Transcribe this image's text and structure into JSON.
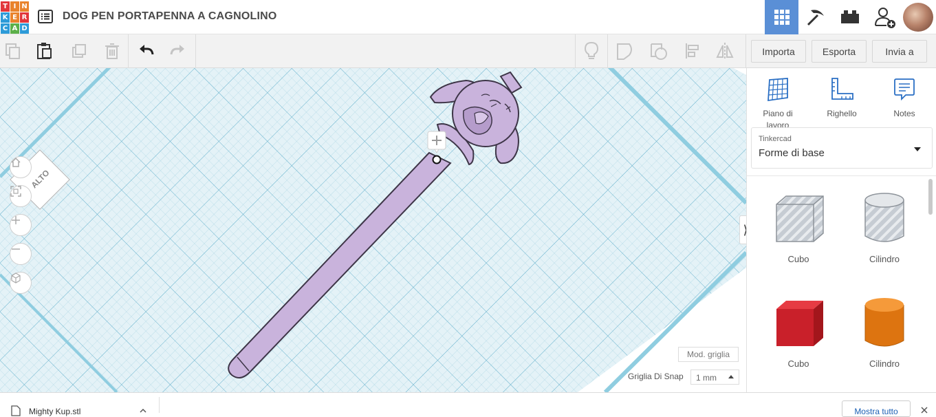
{
  "app": {
    "logo_letters": [
      "T",
      "I",
      "N",
      "K",
      "E",
      "R",
      "C",
      "A",
      "D"
    ],
    "logo_colors": [
      "#e2363b",
      "#e9832c",
      "#e9832c",
      "#2d9bd8",
      "#e9832c",
      "#e2363b",
      "#2d9bd8",
      "#5cb04a",
      "#2d9bd8"
    ],
    "title": "DOG PEN PORTAPENNA A CAGNOLINO",
    "menu_icon": "list-icon",
    "accent": "#5a8fd6"
  },
  "header_modes": [
    {
      "name": "3d-view-icon",
      "active": true
    },
    {
      "name": "pickaxe-icon",
      "active": false
    },
    {
      "name": "bricks-icon",
      "active": false
    },
    {
      "name": "add-user-icon",
      "active": false
    }
  ],
  "toolbar": {
    "actions": [
      "copy-icon",
      "paste-icon",
      "duplicate-icon",
      "trash-icon",
      "undo-icon",
      "redo-icon"
    ],
    "right_actions": [
      "light-bulb-icon",
      "shape-icon",
      "group-icon",
      "align-icon",
      "mirror-icon"
    ],
    "import_label": "Importa",
    "export_label": "Esporta",
    "send_label": "Invia a"
  },
  "workplane": {
    "viewcube_label": "ALTO",
    "nav_buttons": [
      "home-icon",
      "fit-icon",
      "zoom-in-icon",
      "zoom-out-icon",
      "perspective-icon"
    ],
    "grid_edit_label": "Mod. griglia",
    "snap_label": "Griglia Di Snap",
    "snap_value": "1 mm"
  },
  "panel": {
    "tools": [
      {
        "label": "Piano di lavoro",
        "icon": "workplane-icon"
      },
      {
        "label": "Righello",
        "icon": "ruler-icon"
      },
      {
        "label": "Notes",
        "icon": "notes-icon"
      }
    ],
    "library_source": "Tinkercad",
    "library_name": "Forme di base",
    "shapes": [
      {
        "label": "Cubo",
        "kind": "box-hole"
      },
      {
        "label": "Cilindro",
        "kind": "cylinder-hole"
      },
      {
        "label": "Cubo",
        "kind": "box-red",
        "color": "#d3222a"
      },
      {
        "label": "Cilindro",
        "kind": "cylinder-orange",
        "color": "#ea7f17"
      }
    ]
  },
  "bottombar": {
    "download_item": "Mighty Kup.stl",
    "show_all_label": "Mostra tutto"
  }
}
